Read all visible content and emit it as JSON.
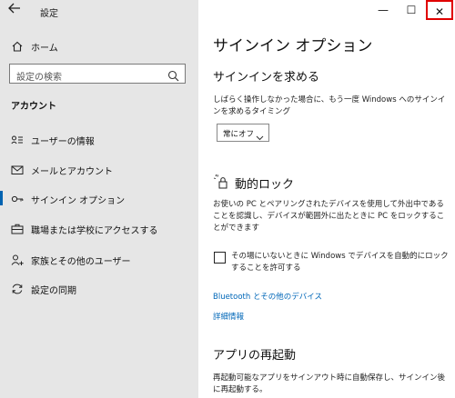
{
  "window": {
    "title": "設定",
    "controls": {
      "minimize": "—",
      "maximize": "☐",
      "close": "✕"
    },
    "close_highlight_color": "#e00000"
  },
  "sidebar": {
    "back_icon": "back-arrow-icon",
    "home_label": "ホーム",
    "search_placeholder": "設定の検索",
    "section_title": "アカウント",
    "items": [
      {
        "label": "ユーザーの情報",
        "icon": "user-info-icon"
      },
      {
        "label": "メールとアカウント",
        "icon": "mail-icon"
      },
      {
        "label": "サインイン オプション",
        "icon": "key-icon",
        "active": true
      },
      {
        "label": "職場または学校にアクセスする",
        "icon": "briefcase-icon"
      },
      {
        "label": "家族とその他のユーザー",
        "icon": "person-add-icon"
      },
      {
        "label": "設定の同期",
        "icon": "sync-icon"
      }
    ],
    "accent_color": "#0063b1"
  },
  "main": {
    "page_title": "サインイン オプション",
    "require_signin": {
      "heading": "サインインを求める",
      "description": "しばらく操作しなかった場合に、もう一度 Windows へのサインインを求めるタイミング",
      "dropdown_value": "常にオフ"
    },
    "dynamic_lock": {
      "heading": "動的ロック",
      "description": "お使いの PC とペアリングされたデバイスを使用して外出中であることを認識し、デバイスが範囲外に出たときに PC をロックすることができます",
      "checkbox_label": "その場にいないときに Windows でデバイスを自動的にロックすることを許可する",
      "checkbox_checked": false,
      "link_bluetooth": "Bluetooth とその他のデバイス",
      "link_more": "詳細情報"
    },
    "restart_apps": {
      "heading": "アプリの再起動",
      "description": "再起動可能なアプリをサインアウト時に自動保存し、サインイン後に再起動する。"
    },
    "link_color": "#0067b8"
  }
}
